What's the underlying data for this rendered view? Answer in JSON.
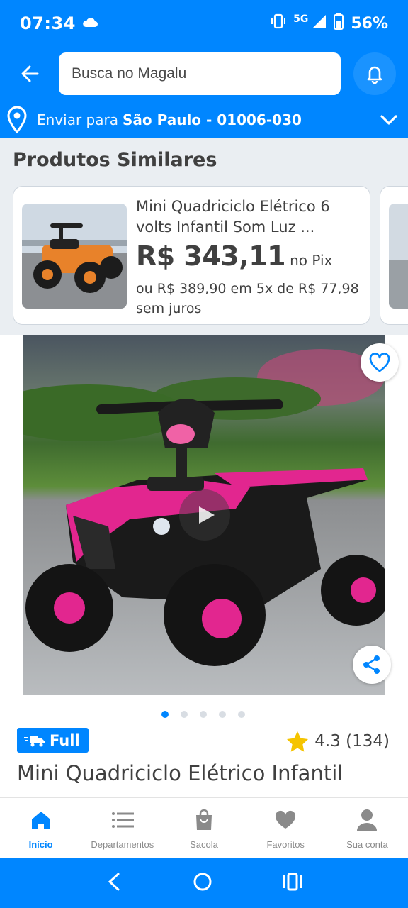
{
  "status_bar": {
    "time": "07:34",
    "network": "5G",
    "battery": "56%"
  },
  "header": {
    "search_placeholder": "Busca no Magalu",
    "delivery_label": "Enviar para",
    "delivery_destination": "São Paulo - 01006-030"
  },
  "similar": {
    "title": "Produtos Similares",
    "card": {
      "name": "Mini Quadriciclo Elétrico 6 volts Infantil Som Luz ...",
      "price": "R$ 343,11",
      "price_suffix": "no Pix",
      "installments": "ou R$ 389,90 em 5x de R$ 77,98 sem juros"
    }
  },
  "gallery": {
    "dot_count": 5,
    "active_index": 0
  },
  "product": {
    "badge": "Full",
    "rating": "4.3 (134)",
    "title": "Mini Quadriciclo Elétrico Infantil"
  },
  "tabs": [
    {
      "label": "Início",
      "icon": "home-icon"
    },
    {
      "label": "Departamentos",
      "icon": "list-icon"
    },
    {
      "label": "Sacola",
      "icon": "bag-icon"
    },
    {
      "label": "Favoritos",
      "icon": "heart-icon"
    },
    {
      "label": "Sua conta",
      "icon": "user-icon"
    }
  ],
  "colors": {
    "brand_blue": "#0086ff",
    "star_yellow": "#f5c400",
    "text": "#404040"
  }
}
